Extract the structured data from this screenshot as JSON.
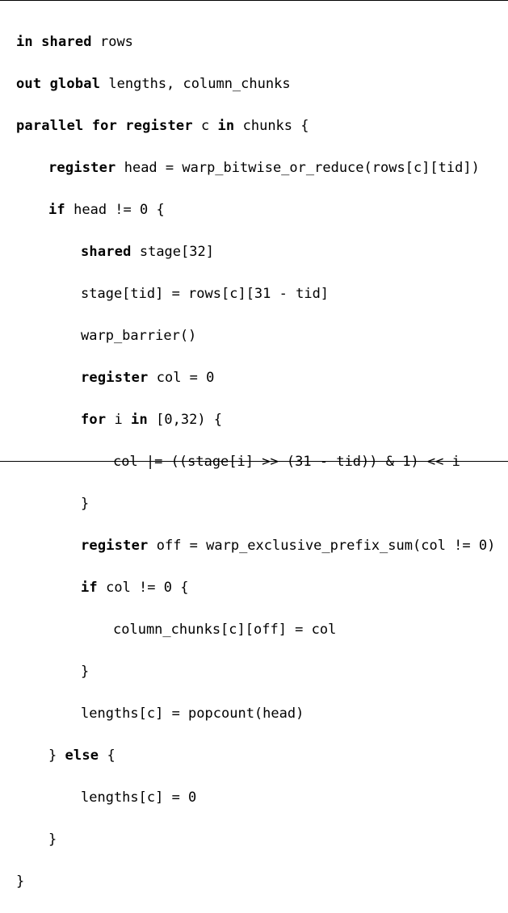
{
  "code": {
    "l01": {
      "kw_in": "in",
      "kw_shared": "shared",
      "rest": " rows"
    },
    "l02": {
      "kw_out": "out",
      "kw_global": "global",
      "rest": " lengths, column_chunks"
    },
    "l03": {
      "kw_parallel": "parallel",
      "kw_for": "for",
      "kw_register": "register",
      "txt_c": " c ",
      "kw_in": "in",
      "rest": " chunks {"
    },
    "l04": {
      "kw_register": "register",
      "rest": " head = warp_bitwise_or_reduce(rows[c][tid])"
    },
    "l05": {
      "kw_if": "if",
      "rest": " head != 0 {"
    },
    "l06": {
      "kw_shared": "shared",
      "rest": " stage[32]"
    },
    "l07": {
      "rest": "stage[tid] = rows[c][31 - tid]"
    },
    "l08": {
      "rest": "warp_barrier()"
    },
    "l09": {
      "kw_register": "register",
      "rest": " col = 0"
    },
    "l10": {
      "kw_for": "for",
      "txt_i": " i ",
      "kw_in": "in",
      "rest": " [0,32) {"
    },
    "l11": {
      "rest": "col |= ((stage[i] >> (31 - tid)) & 1) << i"
    },
    "l12": {
      "rest": "}"
    },
    "l13": {
      "kw_register": "register",
      "rest": " off = warp_exclusive_prefix_sum(col != 0)"
    },
    "l14": {
      "kw_if": "if",
      "rest": " col != 0 {"
    },
    "l15": {
      "rest": "column_chunks[c][off] = col"
    },
    "l16": {
      "rest": "}"
    },
    "l17": {
      "rest": "lengths[c] = popcount(head)"
    },
    "l18": {
      "rest": "} ",
      "kw_else": "else",
      "rest2": " {"
    },
    "l19": {
      "rest": "lengths[c] = 0"
    },
    "l20": {
      "rest": "}"
    },
    "l21": {
      "rest": "}"
    }
  }
}
